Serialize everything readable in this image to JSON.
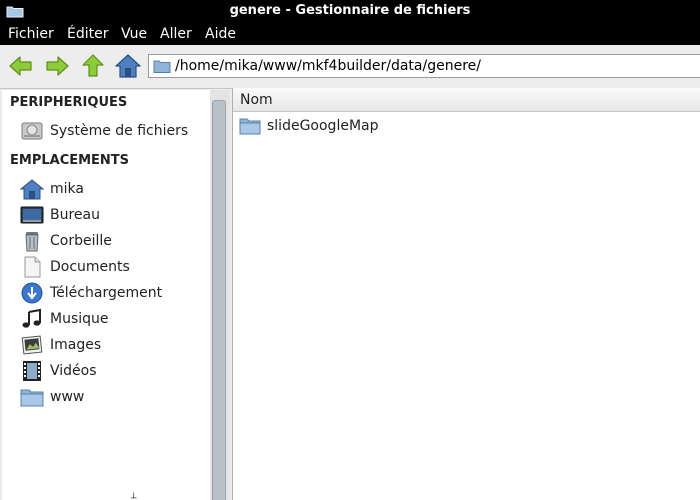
{
  "window": {
    "title": "genere - Gestionnaire de fichiers"
  },
  "menubar": {
    "items": [
      {
        "label": "Fichier"
      },
      {
        "label": "Éditer"
      },
      {
        "label": "Vue"
      },
      {
        "label": "Aller"
      },
      {
        "label": "Aide"
      }
    ]
  },
  "toolbar": {
    "back_icon": "arrow-left-icon",
    "forward_icon": "arrow-right-icon",
    "up_icon": "arrow-up-icon",
    "home_icon": "home-icon",
    "location_path": "/home/mika/www/mkf4builder/data/genere/"
  },
  "sidebar": {
    "devices_title": "PERIPHERIQUES",
    "devices": [
      {
        "label": "Système de fichiers",
        "icon": "hard-disk-icon"
      }
    ],
    "places_title": "EMPLACEMENTS",
    "places": [
      {
        "label": "mika",
        "icon": "home-icon"
      },
      {
        "label": "Bureau",
        "icon": "desktop-icon"
      },
      {
        "label": "Corbeille",
        "icon": "trash-icon"
      },
      {
        "label": "Documents",
        "icon": "document-icon"
      },
      {
        "label": "Téléchargement",
        "icon": "download-icon"
      },
      {
        "label": "Musique",
        "icon": "music-icon"
      },
      {
        "label": "Images",
        "icon": "image-icon"
      },
      {
        "label": "Vidéos",
        "icon": "video-icon"
      },
      {
        "label": "www",
        "icon": "folder-icon"
      }
    ]
  },
  "main": {
    "column_header": "Nom",
    "files": [
      {
        "name": "slideGoogleMap",
        "icon": "folder-icon"
      }
    ]
  },
  "colors": {
    "titlebar_bg": "#000000",
    "arrow_green": "#8ccb3a",
    "folder_blue": "#8fb4d8"
  }
}
